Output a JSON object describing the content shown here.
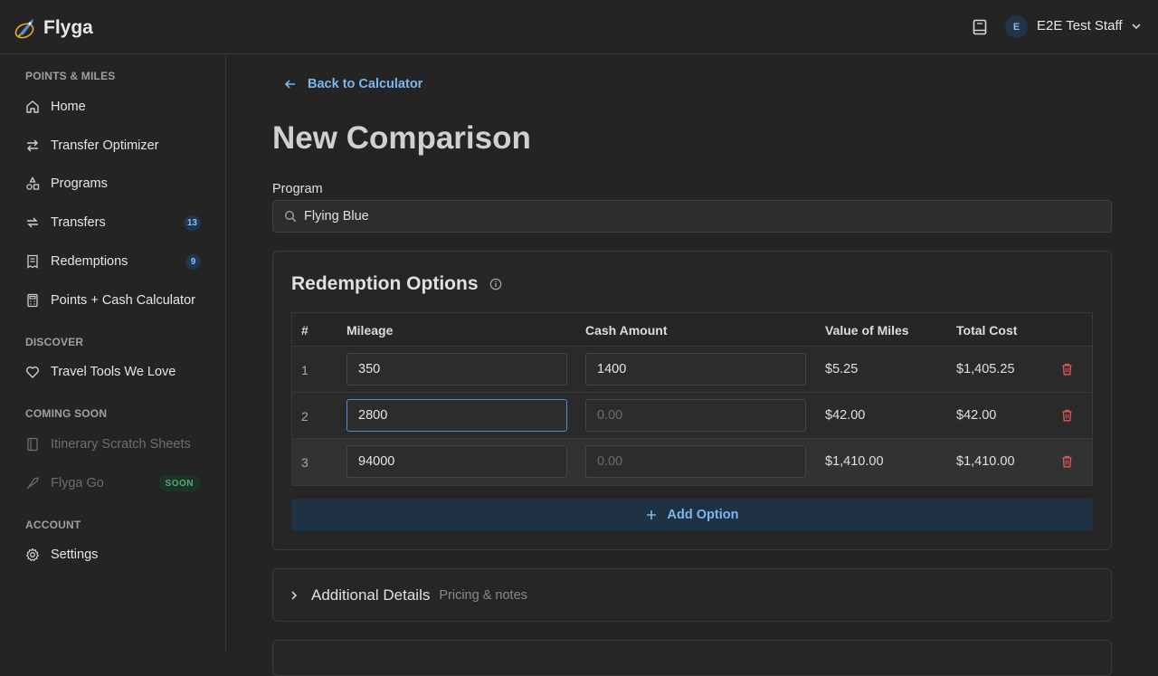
{
  "app": {
    "name": "Flyga"
  },
  "header": {
    "user_initial": "E",
    "user_name": "E2E Test Staff"
  },
  "sidebar": {
    "sections": [
      {
        "title": "POINTS & MILES"
      },
      {
        "title": "DISCOVER"
      },
      {
        "title": "COMING SOON"
      },
      {
        "title": "ACCOUNT"
      }
    ],
    "items": [
      {
        "label": "Home",
        "icon": "home-icon"
      },
      {
        "label": "Transfer Optimizer",
        "icon": "arrows-exchange-icon"
      },
      {
        "label": "Programs",
        "icon": "shapes-icon"
      },
      {
        "label": "Transfers",
        "icon": "transfer-icon",
        "badge": "13"
      },
      {
        "label": "Redemptions",
        "icon": "receipt-icon",
        "badge": "9"
      },
      {
        "label": "Points + Cash Calculator",
        "icon": "calculator-icon"
      },
      {
        "label": "Travel Tools We Love",
        "icon": "heart-icon"
      },
      {
        "label": "Itinerary Scratch Sheets",
        "icon": "notebook-icon"
      },
      {
        "label": "Flyga Go",
        "icon": "rocket-icon",
        "badge": "SOON"
      },
      {
        "label": "Settings",
        "icon": "gear-icon"
      }
    ]
  },
  "main": {
    "back_label": "Back to Calculator",
    "title": "New Comparison",
    "program_label": "Program",
    "program_value": "Flying Blue",
    "options": {
      "title": "Redemption Options",
      "columns": [
        "#",
        "Mileage",
        "Cash Amount",
        "Value of Miles",
        "Total Cost"
      ],
      "rows": [
        {
          "num": "1",
          "mileage": "350",
          "cash": "1400",
          "cash_placeholder": "0.00",
          "value": "$5.25",
          "total": "$1,405.25"
        },
        {
          "num": "2",
          "mileage": "2800",
          "cash": "",
          "cash_placeholder": "0.00",
          "value": "$42.00",
          "total": "$42.00"
        },
        {
          "num": "3",
          "mileage": "94000",
          "cash": "",
          "cash_placeholder": "0.00",
          "value": "$1,410.00",
          "total": "$1,410.00"
        }
      ],
      "add_label": "Add Option"
    },
    "details": {
      "title": "Additional Details",
      "subtitle": "Pricing & notes"
    }
  },
  "colors": {
    "accent": "#7ab6f0",
    "danger": "#e05a5a",
    "soon_green": "#4fae76"
  }
}
